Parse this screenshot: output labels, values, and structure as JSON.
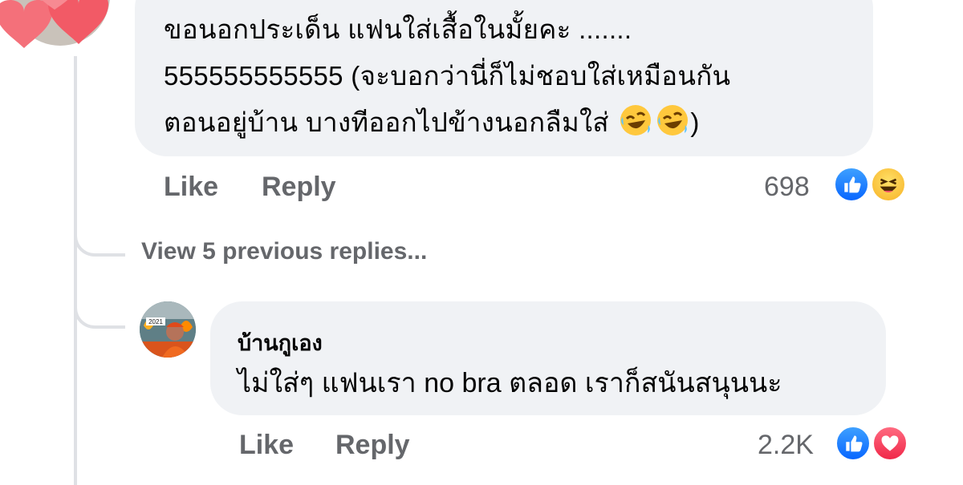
{
  "comment1": {
    "lines": [
      "ขอนอกประเด็น แฟนใส่เสื้อในมั้ยคะ .......",
      "555555555555 (จะบอกว่านี่ก็ไม่ชอบใส่เหมือนกัน",
      "ตอนอยู่บ้าน บางทีออกไปข้างนอกลืมใส่"
    ],
    "line3_suffix": ")",
    "emojis": [
      "rolling-on-floor-laughing-emoji",
      "rolling-on-floor-laughing-emoji"
    ],
    "like_label": "Like",
    "reply_label": "Reply",
    "reaction_count": "698",
    "reactions": [
      "like-reaction-icon",
      "haha-reaction-icon"
    ]
  },
  "thread": {
    "view_previous_label": "View 5 previous replies..."
  },
  "comment2": {
    "author": "บ้านกูเอง",
    "text": "ไม่ใส่ๆ แฟนเรา no bra ตลอด เราก็สนันสนุนนะ",
    "avatar_text": "2021",
    "like_label": "Like",
    "reply_label": "Reply",
    "reaction_count": "2.2K",
    "reactions": [
      "like-reaction-icon",
      "love-reaction-icon"
    ]
  },
  "colors": {
    "bubble_bg": "#f0f2f5",
    "muted_text": "#65676b",
    "thread_line": "#dfe1e5",
    "like_blue": "#0866ff",
    "love_red": "#f02849"
  }
}
